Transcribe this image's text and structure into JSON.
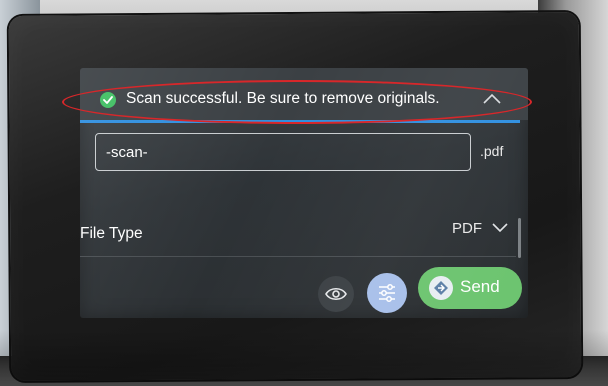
{
  "notification": {
    "message": "Scan successful. Be sure to remove originals.",
    "icon": "check-circle-icon",
    "success_color": "#3fbf62",
    "accent_color": "#2f8fe0"
  },
  "filename": {
    "value": "-scan-",
    "extension": ".pdf"
  },
  "file_type": {
    "label": "File Type",
    "selected": "PDF"
  },
  "actions": {
    "preview_icon": "eye-icon",
    "settings_icon": "sliders-icon",
    "send_label": "Send",
    "send_color": "#6cc46f"
  },
  "annotation": {
    "highlight_color": "#d8272a"
  }
}
